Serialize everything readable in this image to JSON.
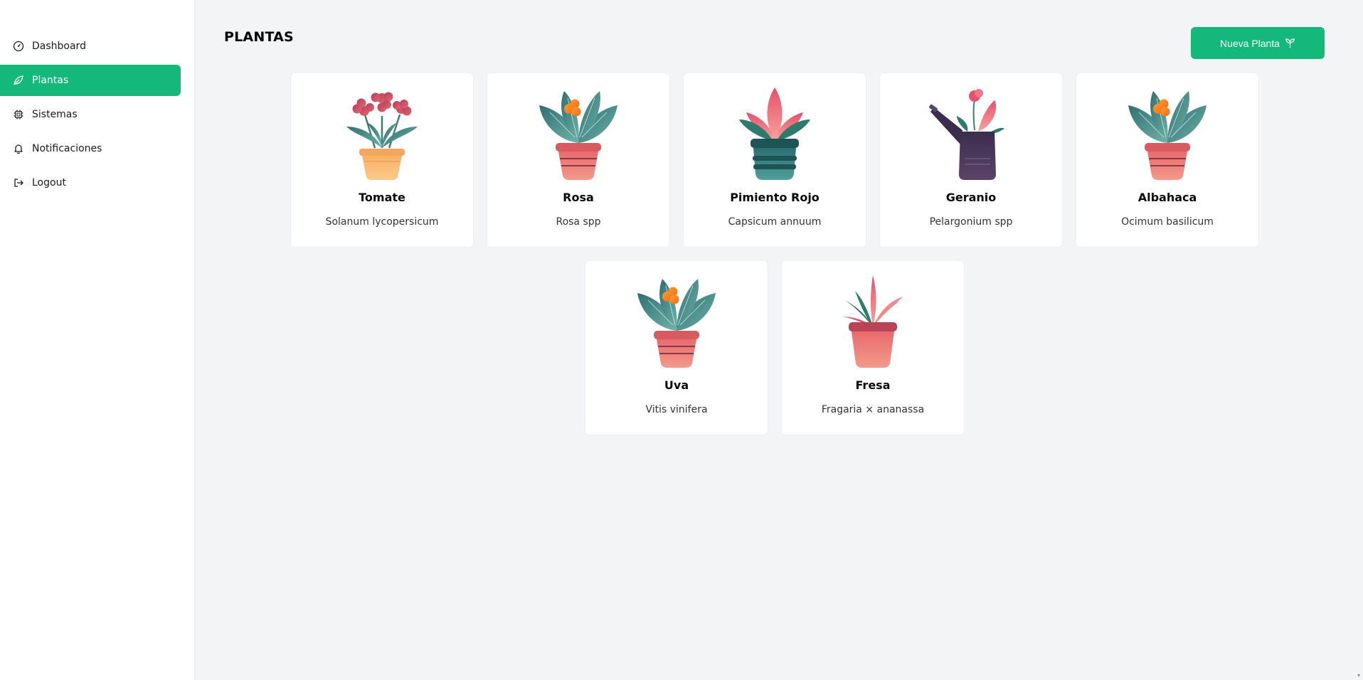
{
  "sidebar": {
    "items": [
      {
        "label": "Dashboard",
        "icon": "dashboard-gauge-icon"
      },
      {
        "label": "Plantas",
        "icon": "leaf-icon",
        "active": true
      },
      {
        "label": "Sistemas",
        "icon": "chip-icon"
      },
      {
        "label": "Notificaciones",
        "icon": "bell-icon"
      },
      {
        "label": "Logout",
        "icon": "logout-icon"
      }
    ]
  },
  "header": {
    "title": "PLANTAS",
    "new_button_label": "Nueva Planta",
    "new_button_icon": "sprout-icon"
  },
  "colors": {
    "accent": "#14b87a",
    "background": "#f3f4f6",
    "card": "#ffffff"
  },
  "plants": [
    {
      "name": "Tomate",
      "scientific": "Solanum lycopersicum",
      "image": "flower-pot-orange-illustration"
    },
    {
      "name": "Rosa",
      "scientific": "Rosa spp",
      "image": "leafy-pot-coral-illustration"
    },
    {
      "name": "Pimiento Rojo",
      "scientific": "Capsicum annuum",
      "image": "plant-pot-teal-illustration"
    },
    {
      "name": "Geranio",
      "scientific": "Pelargonium spp",
      "image": "watering-can-plant-illustration"
    },
    {
      "name": "Albahaca",
      "scientific": "Ocimum basilicum",
      "image": "leafy-pot-coral-illustration"
    },
    {
      "name": "Uva",
      "scientific": "Vitis vinifera",
      "image": "leafy-pot-coral-illustration"
    },
    {
      "name": "Fresa",
      "scientific": "Fragaria × ananassa",
      "image": "spiky-plant-pot-illustration"
    }
  ]
}
